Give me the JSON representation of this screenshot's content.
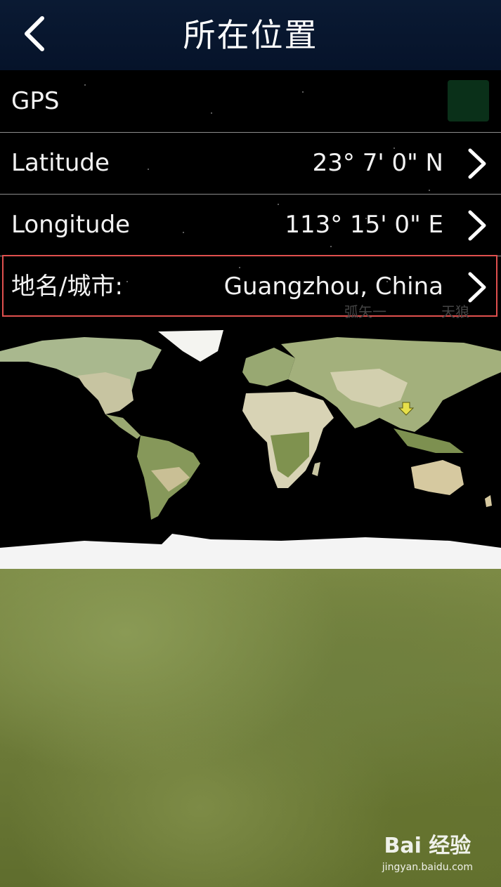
{
  "header": {
    "title": "所在位置"
  },
  "rows": [
    {
      "label": "GPS"
    },
    {
      "label": "Latitude",
      "value": "23° 7' 0\" N"
    },
    {
      "label": "Longitude",
      "value": "113° 15' 0\" E"
    },
    {
      "label": "地名/城市:",
      "value": "Guangzhou, China"
    }
  ],
  "background_labels": [
    "弧矢一",
    "天狼"
  ],
  "watermark": {
    "logo": "Bai 经验",
    "url": "jingyan.baidu.com"
  },
  "colors": {
    "header": "#08172e",
    "gps_toggle": "#0a3019",
    "highlight": "#e0504e",
    "divider": "#8d8d8d"
  }
}
